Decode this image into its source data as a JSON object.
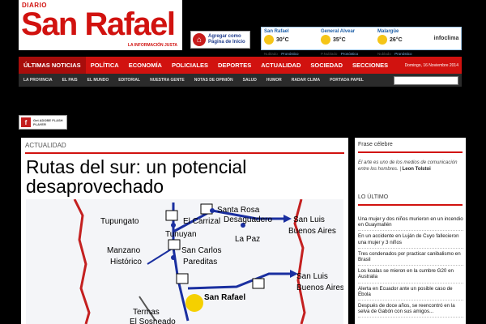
{
  "header": {
    "logo_kicker": "DIARIO",
    "logo_name": "San Rafael",
    "logo_tagline": "LA INFORMACIÓN JUSTA",
    "homepage_label": "Agregar como Página de Inicio",
    "weather": [
      {
        "city": "San Rafael",
        "temp": "30°C",
        "condition": "Nublado",
        "forecast": "Pronóstico"
      },
      {
        "city": "General Alvear",
        "temp": "35°C",
        "condition": "P.Nublado",
        "forecast": "Pronóstico"
      },
      {
        "city": "Malargüe",
        "temp": "26°C",
        "condition": "Nublado",
        "forecast": "Pronóstico"
      }
    ],
    "weather_logo": "infoclima"
  },
  "nav": {
    "items": [
      "ÚLTIMAS NOTICIAS",
      "POLÍTICA",
      "ECONOMÍA",
      "POLICIALES",
      "DEPORTES",
      "ACTUALIDAD",
      "SOCIEDAD",
      "SECCIONES"
    ],
    "date": "Domingo, 16 Noviembre 2014"
  },
  "subnav": {
    "items": [
      "LA PROVINCIA",
      "EL PAIS",
      "EL MUNDO",
      "EDITORIAL",
      "NUESTRA GENTE",
      "NOTAS DE OPINIÓN",
      "SALUD",
      "HUMOR",
      "RADAR CLIMA",
      "PORTADA PAPEL"
    ]
  },
  "band": {
    "flash_label": "Get ADOBE FLASH PLAYER"
  },
  "article": {
    "section": "ACTUALIDAD",
    "title": "Rutas del sur: un potencial desaprovechado",
    "map_labels": [
      "Tupungato",
      "El Carrizal",
      "Tunuyan",
      "Santa Rosa",
      "Desaguadero",
      "La Paz",
      "San Luis",
      "Buenos Aires",
      "Manzano",
      "Histórico",
      "San Carlos",
      "Pareditas",
      "San Luis",
      "Buenos Aires",
      "San Rafael",
      "Termas",
      "El Sosneado"
    ]
  },
  "sidebar": {
    "quote_head": "Frase célebre",
    "quote_text": "El arte es uno de los medios de comunicación entre los hombres.",
    "quote_author": "Leon Tolstoi",
    "latest_head": "LO ÚLTIMO",
    "latest": [
      "Una mujer y dos niños murieron en un incendio en Guaymallén",
      "En un accidente en Luján de Cuyo fallecieron una mujer y 3 niños",
      "Tres condenados por practicar canibalismo en Brasil",
      "Los koalas se mieron en la cumbre G20 en Australia",
      "Alerta en Ecuador ante un posible caso de Ébola",
      "Después de doce años, se reencontró en la selva de Gabón con sus amigos..."
    ]
  }
}
